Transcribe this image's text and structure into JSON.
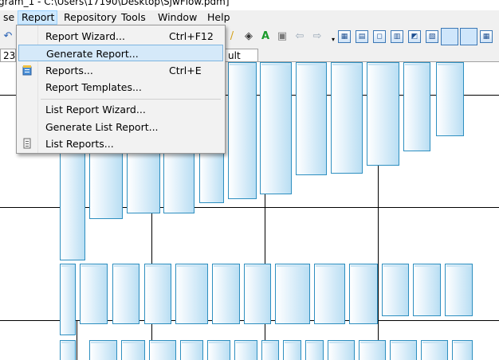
{
  "title": "gram_1 - C:\\Users\\17190\\Desktop\\SjwFlow.pdm]",
  "menubar": {
    "items": [
      "se",
      "Report",
      "Repository",
      "Tools",
      "Window",
      "Help"
    ],
    "active": "Report"
  },
  "toolbar": {
    "icons": [
      "undo-icon",
      "tool-icon",
      "paint-icon",
      "text-icon",
      "image-icon",
      "back-icon",
      "forward-icon",
      "view1-icon",
      "view2-icon",
      "view3-icon",
      "view4-icon",
      "view5-icon",
      "view6-icon",
      "view7-icon",
      "view8-icon"
    ]
  },
  "tabs": [
    "23",
    "ult List"
  ],
  "report_menu": {
    "items": [
      {
        "label": "Report Wizard...",
        "shortcut": "Ctrl+F12",
        "icon": ""
      },
      {
        "label": "Generate Report...",
        "shortcut": "",
        "icon": "",
        "highlighted": true
      },
      {
        "label": "Reports...",
        "shortcut": "Ctrl+E",
        "icon": "reports-icon"
      },
      {
        "label": "Report Templates...",
        "shortcut": "",
        "icon": ""
      },
      {
        "label": "List Report Wizard...",
        "shortcut": "",
        "icon": ""
      },
      {
        "label": "Generate List Report...",
        "shortcut": "",
        "icon": ""
      },
      {
        "label": "List Reports...",
        "shortcut": "",
        "icon": "list-reports-icon"
      }
    ]
  },
  "colors": {
    "bar_border": "#2e8fc0",
    "bar_fill": "#b9def3",
    "menu_highlight": "#d5e9f9",
    "menu_bg": "#f2f2f2"
  }
}
